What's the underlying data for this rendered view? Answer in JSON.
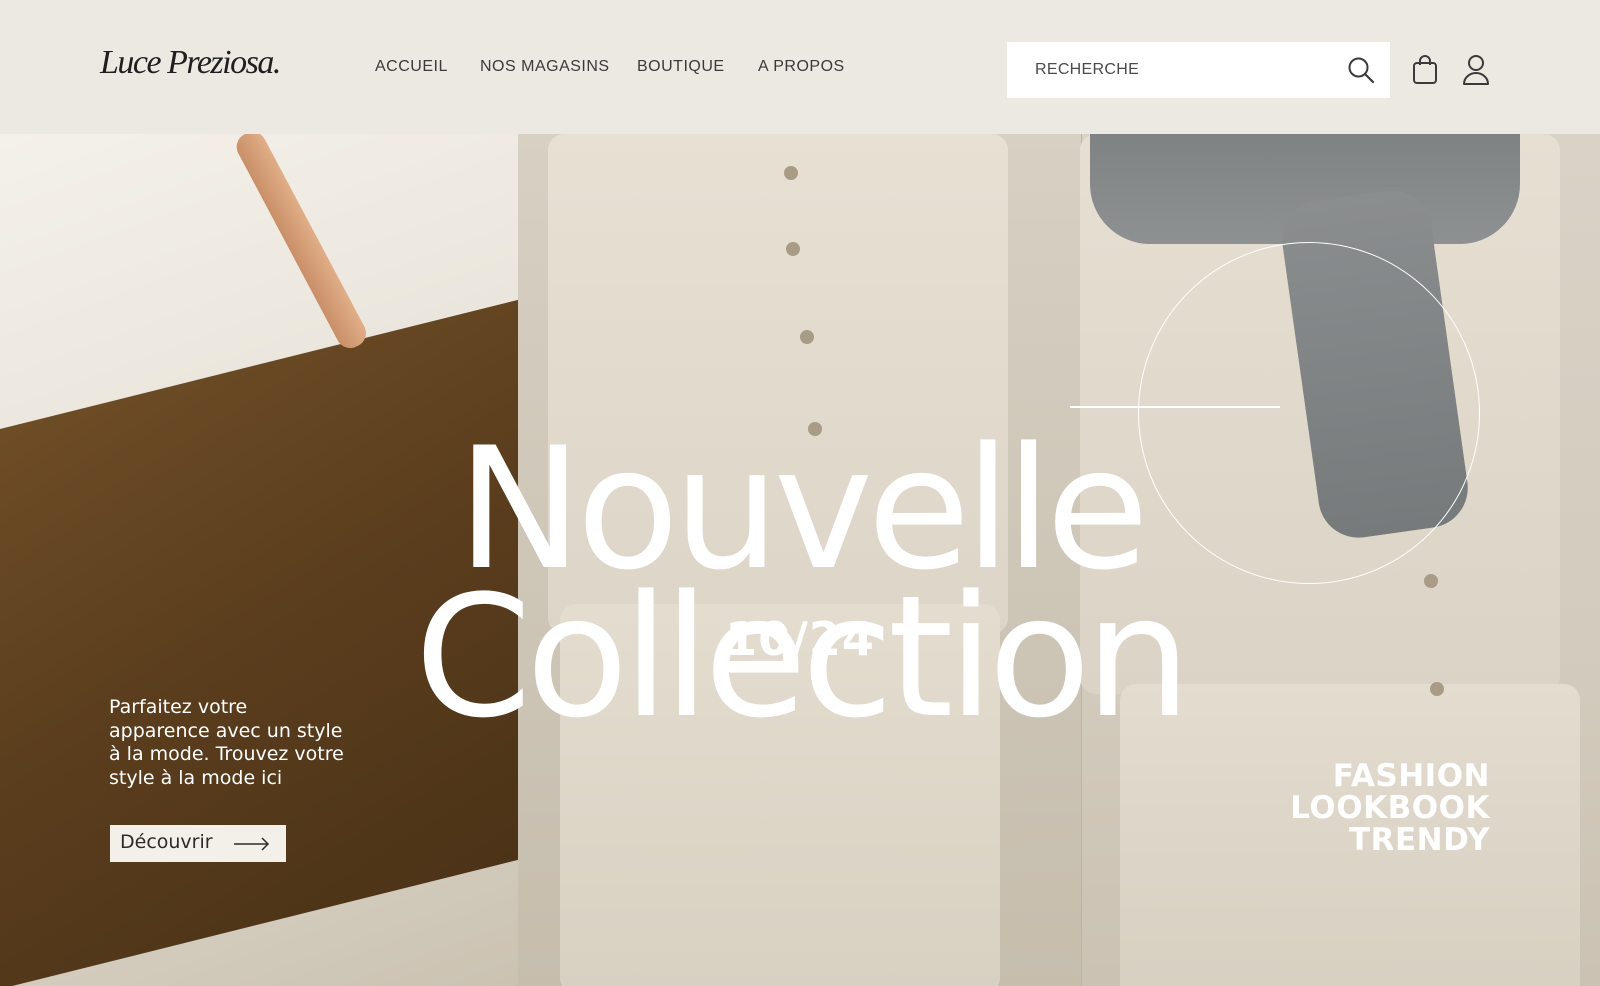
{
  "header": {
    "logo": "Luce Preziosa.",
    "nav": [
      "ACCUEIL",
      "NOS MAGASINS",
      "BOUTIQUE",
      "A PROPOS"
    ],
    "search": {
      "placeholder": "RECHERCHE",
      "icon": "search-icon"
    },
    "icons": [
      "shopping-bag-icon",
      "user-icon"
    ]
  },
  "hero": {
    "title_line1": "Nouvelle",
    "title_line2": "Collection",
    "date": "10/24",
    "tagline": "Parfaitez votre apparence avec un style à la mode. Trouvez votre style à la mode ici",
    "cta_label": "Découvrir",
    "cta_icon": "arrow-right-icon",
    "tags": [
      "FASHION",
      "LOOKBOOK",
      "TRENDY"
    ]
  },
  "colors": {
    "background": "#ece8e2",
    "text_dark": "#3a3a3a",
    "white": "#ffffff",
    "brown": "#5a3d1d",
    "beige": "#d7d0c3"
  }
}
